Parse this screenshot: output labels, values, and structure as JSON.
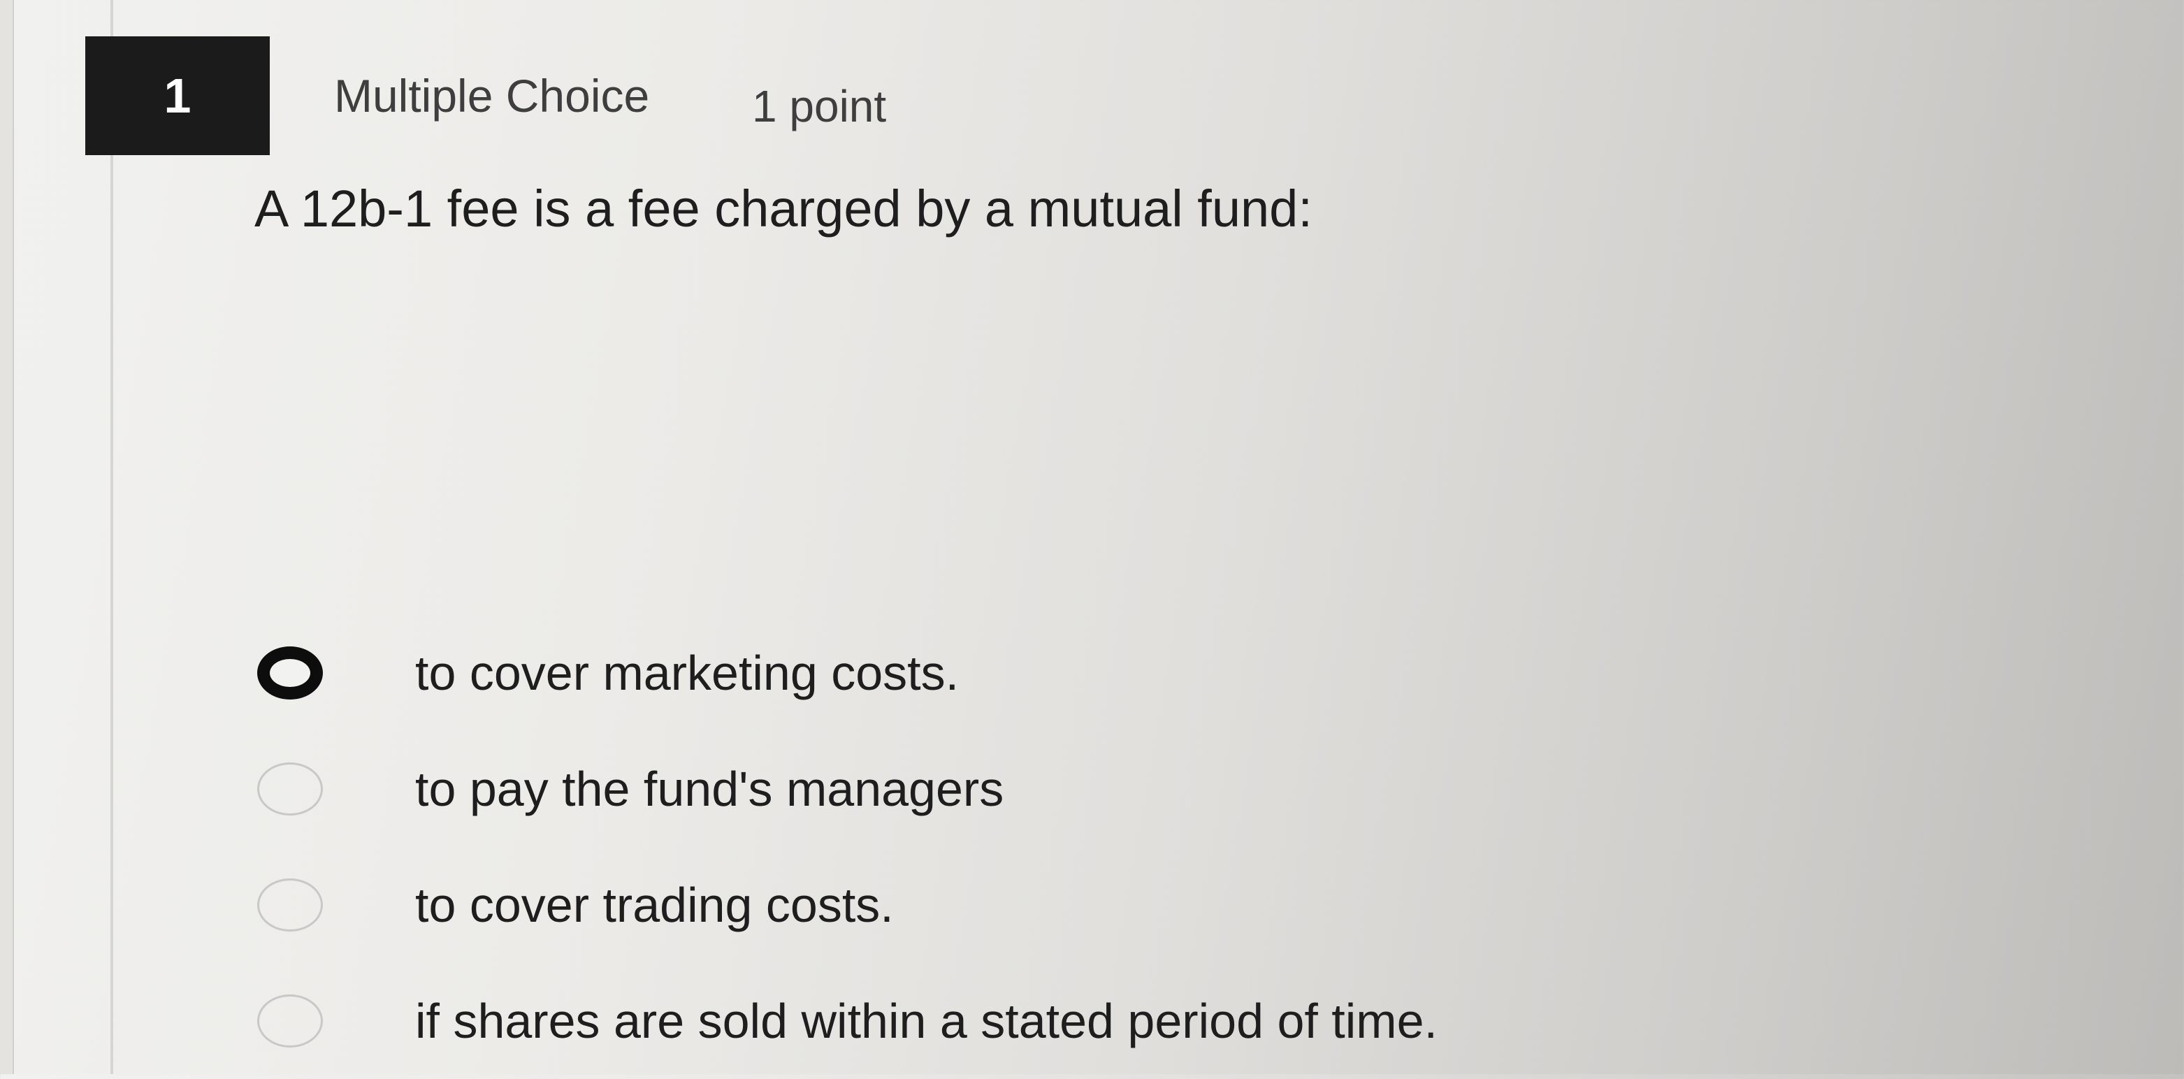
{
  "question": {
    "number": "1",
    "type": "Multiple Choice",
    "points": "1 point",
    "text": "A 12b-1 fee is a fee charged by a mutual fund:"
  },
  "options": [
    {
      "label": "to cover marketing costs.",
      "selected": true
    },
    {
      "label": "to pay the fund's managers",
      "selected": false
    },
    {
      "label": "to cover trading costs.",
      "selected": false
    },
    {
      "label": "if shares are sold within a stated period of time.",
      "selected": false
    }
  ]
}
